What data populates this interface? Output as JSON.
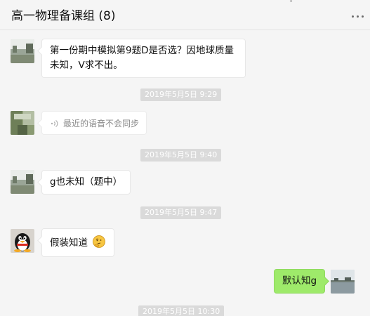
{
  "chat": {
    "title": "高一物理备课组 (8)"
  },
  "icons": {
    "more": "more-dots-icon",
    "voice": "voice-wave-icon",
    "emoji": "thinking-face-emoji-icon"
  },
  "colors": {
    "background": "#f5f5f5",
    "bubble_incoming": "#ffffff",
    "bubble_outgoing": "#9eea6a",
    "timestamp_bg": "#dadada"
  },
  "messages": [
    {
      "type": "text",
      "direction": "incoming",
      "text_line1": "第一份期中模拟第9题D是否选？因地球质量",
      "text_line2": "未知，V求不出。"
    },
    {
      "type": "timestamp",
      "text": "2019年5月5日 9:29"
    },
    {
      "type": "voice",
      "direction": "incoming",
      "text": "最近的语音不会同步"
    },
    {
      "type": "timestamp",
      "text": "2019年5月5日 9:40"
    },
    {
      "type": "text",
      "direction": "incoming",
      "text": "g也未知（题中）"
    },
    {
      "type": "timestamp",
      "text": "2019年5月5日 9:47"
    },
    {
      "type": "text",
      "direction": "incoming",
      "text": "假装知道"
    },
    {
      "type": "text",
      "direction": "outgoing",
      "text": "默认知g"
    },
    {
      "type": "timestamp",
      "text": "2019年5月5日 10:30"
    }
  ]
}
